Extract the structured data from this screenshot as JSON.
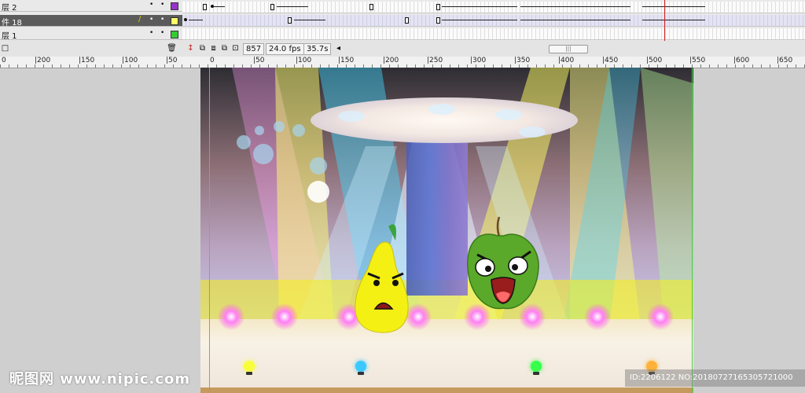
{
  "timeline": {
    "layers": [
      {
        "name": "层 2",
        "color": "#9933cc",
        "selected": false
      },
      {
        "name": "件 18",
        "color": "#ffff66",
        "selected": true
      },
      {
        "name": "层 1",
        "color": "#33cc33",
        "selected": false
      }
    ],
    "icons": [
      "pencil-icon",
      "eye-dot-icon",
      "lock-dot-icon",
      "trash-icon"
    ]
  },
  "statusbar": {
    "frame": "857",
    "fps": "24.0 fps",
    "time": "35.7s",
    "scroll_left_arrow": "◂",
    "scroll_grip": "|||"
  },
  "ruler": {
    "labels": [
      "0",
      "|200",
      "|150",
      "|100",
      "|50",
      "0",
      "|50",
      "|100",
      "|150",
      "|200",
      "|250",
      "|300",
      "|350",
      "|400",
      "|450",
      "|500",
      "|550",
      "|600",
      "|650"
    ]
  },
  "stage": {
    "accent_yellow": "#f5f014",
    "accent_green": "#5aa92a",
    "light_colors": [
      "#ff66ee",
      "#f8ff3a",
      "#3ac8ff",
      "#38ff4a",
      "#ffb23a"
    ],
    "characters": [
      "pear-character",
      "apple-character"
    ]
  },
  "watermark": {
    "site": "昵图网 www.nipic.com",
    "id_text": "ID:2206122 NO:20180727165305721000"
  }
}
